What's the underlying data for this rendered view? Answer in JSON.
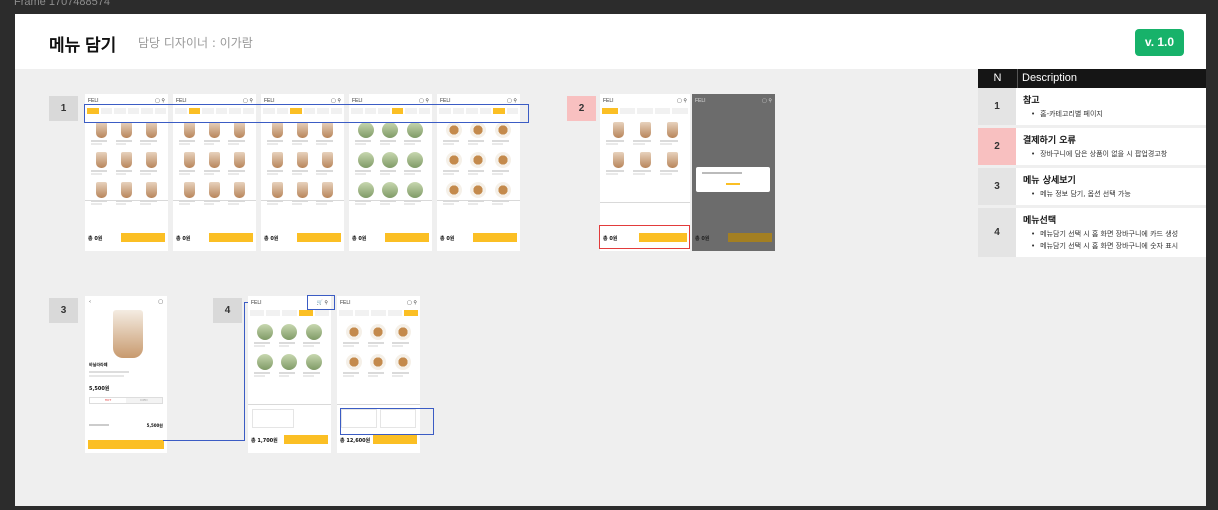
{
  "frame_label": "Frame 1707488574",
  "header": {
    "title": "메뉴 담기",
    "designer": "담당 디자이너 : 이가람",
    "version": "v. 1.0"
  },
  "accent_colors": {
    "version": "#17b26a",
    "primary": "#fbbf24",
    "highlight": "#3b5cc4",
    "error": "#e23b3b",
    "error_badge": "#f8c0c0"
  },
  "badges": [
    "1",
    "2",
    "3",
    "4"
  ],
  "screens": {
    "logo": "FELI",
    "total": "총 0원",
    "total_cart_a": "총 1,700원",
    "total_cart_b": "총 12,600원",
    "detail_price": "5,500원",
    "detail_total": "5,500원",
    "detail_option_a": "HOT",
    "detail_option_b": "ICED",
    "detail_name": "바닐라라떼"
  },
  "table": {
    "head": {
      "n": "N",
      "description": "Description"
    },
    "rows": [
      {
        "n": "1",
        "title": "참고",
        "items": [
          "홈-카테고리별 페이지"
        ]
      },
      {
        "n": "2",
        "title": "결제하기 오류",
        "items": [
          "장바구니에 담은 상품이 없을 시 팝업경고창"
        ]
      },
      {
        "n": "3",
        "title": "메뉴 상세보기",
        "items": [
          "메뉴 정보 담기, 옵션 선택 가능"
        ]
      },
      {
        "n": "4",
        "title": "메뉴선택",
        "items": [
          "메뉴담기 선택 시 홈 화면 장바구니에 카드 생성",
          "메뉴담기 선택 시 홈 화면 장바구니에 숫자 표시"
        ]
      }
    ]
  }
}
